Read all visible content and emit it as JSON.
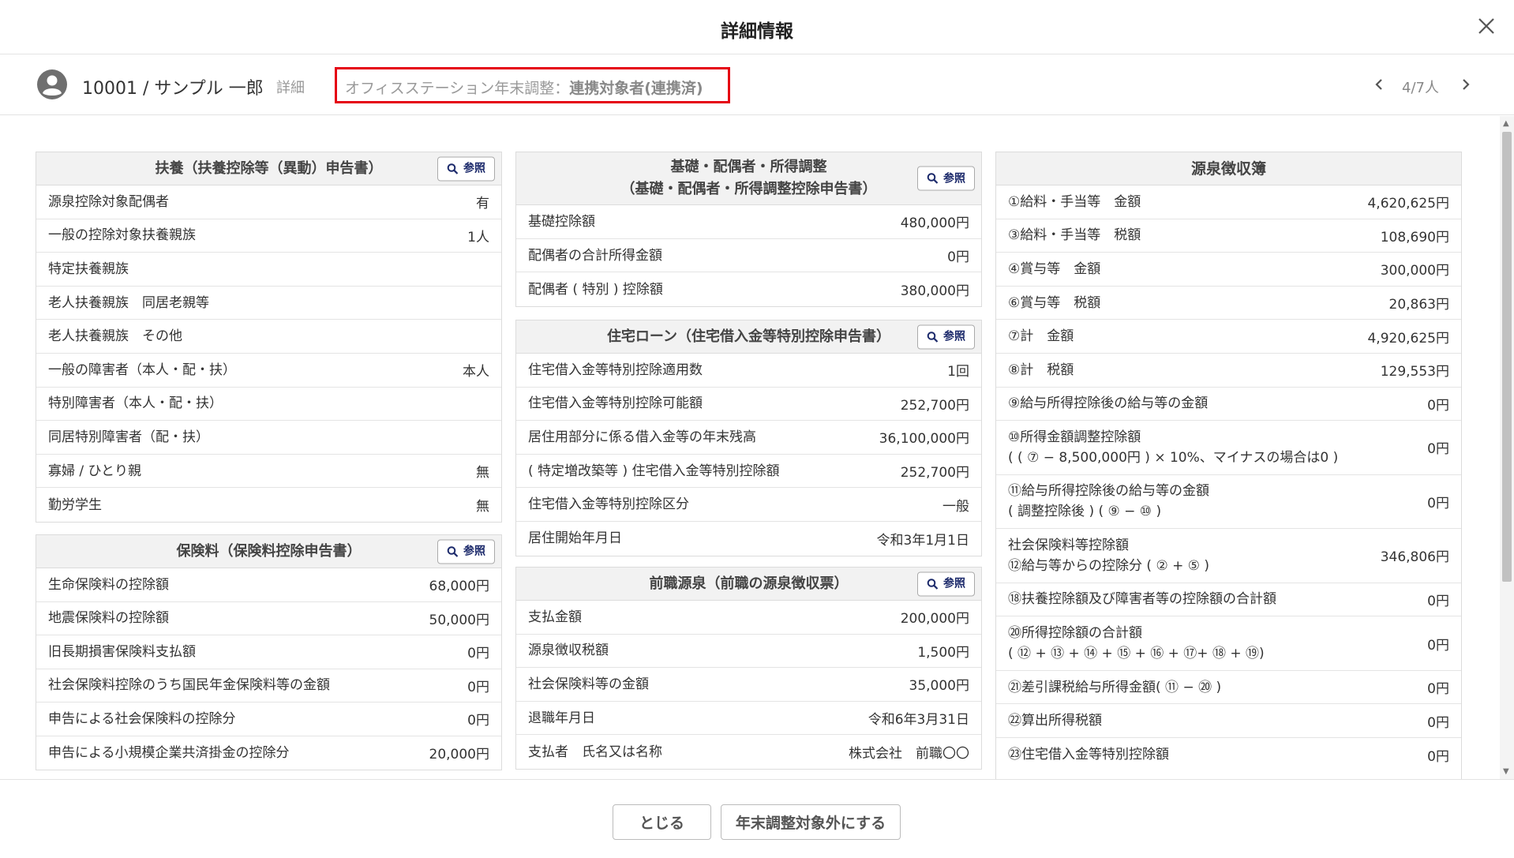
{
  "modal": {
    "title": "詳細情報",
    "close_icon": "close-icon"
  },
  "employee": {
    "name": "10001 / サンプル 一郎",
    "detail_link": "詳細",
    "status_prefix": "オフィスステーション年末調整：",
    "status_value": "連携対象者(連携済)",
    "status_box_color": "#e50012",
    "pager_count": "4/7人"
  },
  "ref_label": "参照",
  "panels": {
    "dependents": {
      "title": "扶養（扶養控除等（異動）申告書）",
      "rows": [
        {
          "label": "源泉控除対象配偶者",
          "value": "有"
        },
        {
          "label": "一般の控除対象扶養親族",
          "value": "1人"
        },
        {
          "label": "特定扶養親族",
          "value": ""
        },
        {
          "label": "老人扶養親族　同居老親等",
          "value": ""
        },
        {
          "label": "老人扶養親族　その他",
          "value": ""
        },
        {
          "label": "一般の障害者（本人・配・扶）",
          "value": "本人"
        },
        {
          "label": "特別障害者（本人・配・扶）",
          "value": ""
        },
        {
          "label": "同居特別障害者（配・扶）",
          "value": ""
        },
        {
          "label": "寡婦 / ひとり親",
          "value": "無"
        },
        {
          "label": "勤労学生",
          "value": "無"
        }
      ]
    },
    "insurance": {
      "title": "保険料（保険料控除申告書）",
      "rows": [
        {
          "label": "生命保険料の控除額",
          "value": "68,000円"
        },
        {
          "label": "地震保険料の控除額",
          "value": "50,000円"
        },
        {
          "label": "旧長期損害保険料支払額",
          "value": "0円"
        },
        {
          "label": "社会保険料控除のうち国民年金保険料等の金額",
          "value": "0円"
        },
        {
          "label": "申告による社会保険料の控除分",
          "value": "0円"
        },
        {
          "label": "申告による小規模企業共済掛金の控除分",
          "value": "20,000円"
        }
      ]
    },
    "basic": {
      "title_line1": "基礎・配偶者・所得調整",
      "title_line2": "（基礎・配偶者・所得調整控除申告書）",
      "rows": [
        {
          "label": "基礎控除額",
          "value": "480,000円"
        },
        {
          "label": "配偶者の合計所得金額",
          "value": "0円"
        },
        {
          "label": "配偶者 ( 特別 ) 控除額",
          "value": "380,000円"
        }
      ]
    },
    "housing": {
      "title": "住宅ローン（住宅借入金等特別控除申告書）",
      "rows": [
        {
          "label": "住宅借入金等特別控除適用数",
          "value": "1回"
        },
        {
          "label": "住宅借入金等特別控除可能額",
          "value": "252,700円"
        },
        {
          "label": "居住用部分に係る借入金等の年末残高",
          "value": "36,100,000円"
        },
        {
          "label": "( 特定増改築等 ) 住宅借入金等特別控除額",
          "value": "252,700円"
        },
        {
          "label": "住宅借入金等特別控除区分",
          "value": "一般"
        },
        {
          "label": "居住開始年月日",
          "value": "令和3年1月1日"
        }
      ]
    },
    "previous": {
      "title": "前職源泉（前職の源泉徴収票）",
      "rows": [
        {
          "label": "支払金額",
          "value": "200,000円"
        },
        {
          "label": "源泉徴収税額",
          "value": "1,500円"
        },
        {
          "label": "社会保険料等の金額",
          "value": "35,000円"
        },
        {
          "label": "退職年月日",
          "value": "令和6年3月31日"
        },
        {
          "label": "支払者　氏名又は名称",
          "value": "株式会社　前職〇〇"
        }
      ]
    },
    "ledger": {
      "title": "源泉徴収簿",
      "rows": [
        {
          "label": "①給料・手当等　金額",
          "value": "4,620,625円"
        },
        {
          "label": "③給料・手当等　税額",
          "value": "108,690円"
        },
        {
          "label": "④賞与等　金額",
          "value": "300,000円"
        },
        {
          "label": "⑥賞与等　税額",
          "value": "20,863円"
        },
        {
          "label": "⑦計　金額",
          "value": "4,920,625円"
        },
        {
          "label": "⑧計　税額",
          "value": "129,553円"
        },
        {
          "label": "⑨給与所得控除後の給与等の金額",
          "value": "0円"
        },
        {
          "label": "⑩所得金額調整控除額",
          "label2": "( ( ⑦ − 8,500,000円 ) × 10%、マイナスの場合は0 )",
          "value": "0円"
        },
        {
          "label": "⑪給与所得控除後の給与等の金額",
          "label2": "( 調整控除後 ) ( ⑨ − ⑩ )",
          "value": "0円"
        },
        {
          "label": "社会保険料等控除額",
          "label2": "⑫給与等からの控除分 ( ② + ⑤ )",
          "value": "346,806円"
        },
        {
          "label": "⑱扶養控除額及び障害者等の控除額の合計額",
          "value": "0円"
        },
        {
          "label": "⑳所得控除額の合計額",
          "label2": "( ⑫ + ⑬ + ⑭ + ⑮ + ⑯ + ⑰+ ⑱ + ⑲)",
          "value": "0円"
        },
        {
          "label": "㉑差引課税給与所得金額( ⑪ − ⑳ )",
          "value": "0円"
        },
        {
          "label": "㉒算出所得税額",
          "value": "0円"
        },
        {
          "label": "㉓住宅借入金等特別控除額",
          "value": "0円"
        }
      ]
    }
  },
  "footer": {
    "close_label": "とじる",
    "exclude_label": "年末調整対象外にする"
  }
}
